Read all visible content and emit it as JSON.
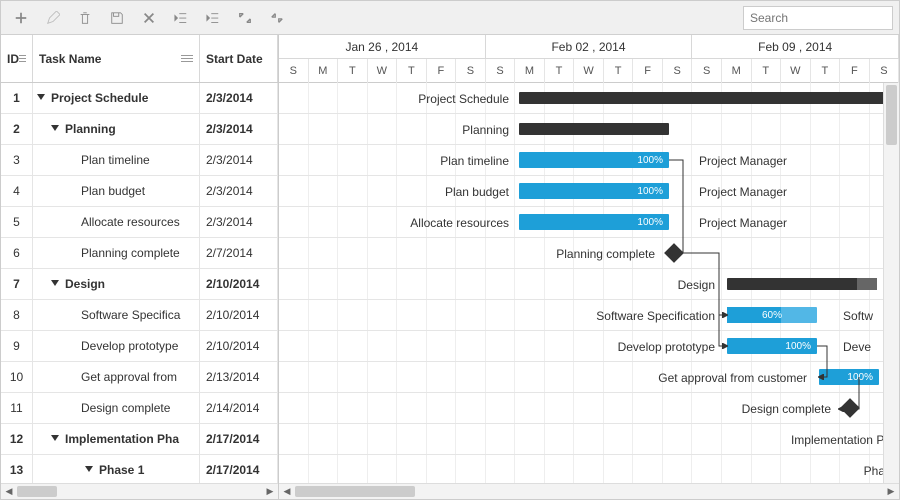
{
  "search": {
    "placeholder": "Search"
  },
  "columns": {
    "id": "ID",
    "task": "Task Name",
    "start": "Start Date"
  },
  "weeks": [
    "Jan 26 , 2014",
    "Feb 02 , 2014",
    "Feb 09 , 2014"
  ],
  "days": [
    "S",
    "M",
    "T",
    "W",
    "T",
    "F",
    "S",
    "S",
    "M",
    "T",
    "W",
    "T",
    "F",
    "S",
    "S",
    "M",
    "T",
    "W",
    "T",
    "F",
    "S"
  ],
  "rows": [
    {
      "id": "1",
      "name": "Project Schedule",
      "start": "2/3/2014",
      "summary": true,
      "ind": 1
    },
    {
      "id": "2",
      "name": "Planning",
      "start": "2/3/2014",
      "summary": true,
      "ind": 2
    },
    {
      "id": "3",
      "name": "Plan timeline",
      "start": "2/3/2014",
      "summary": false,
      "ind": 3
    },
    {
      "id": "4",
      "name": "Plan budget",
      "start": "2/3/2014",
      "summary": false,
      "ind": 3
    },
    {
      "id": "5",
      "name": "Allocate resources",
      "start": "2/3/2014",
      "summary": false,
      "ind": 3
    },
    {
      "id": "6",
      "name": "Planning complete",
      "start": "2/7/2014",
      "summary": false,
      "ind": 3
    },
    {
      "id": "7",
      "name": "Design",
      "start": "2/10/2014",
      "summary": true,
      "ind": 2
    },
    {
      "id": "8",
      "name": "Software Specification",
      "start": "2/10/2014",
      "summary": false,
      "ind": 3
    },
    {
      "id": "9",
      "name": "Develop prototype",
      "start": "2/10/2014",
      "summary": false,
      "ind": 3
    },
    {
      "id": "10",
      "name": "Get approval from customer",
      "start": "2/13/2014",
      "summary": false,
      "ind": 3
    },
    {
      "id": "11",
      "name": "Design complete",
      "start": "2/14/2014",
      "summary": false,
      "ind": 3
    },
    {
      "id": "12",
      "name": "Implementation Phase",
      "start": "2/17/2014",
      "summary": true,
      "ind": 2,
      "trunc": "Implementation Ph"
    },
    {
      "id": "13",
      "name": "Phase 1",
      "start": "2/17/2014",
      "summary": true,
      "ind": 4,
      "trunc": "Phas"
    }
  ],
  "chart_data": {
    "type": "gantt",
    "weeks": [
      "Jan 26 , 2014",
      "Feb 02 , 2014",
      "Feb 09 , 2014"
    ],
    "tasks": [
      {
        "id": 1,
        "name": "Project Schedule",
        "type": "summary",
        "start": "2/3/2014",
        "end": null
      },
      {
        "id": 2,
        "name": "Planning",
        "type": "summary",
        "start": "2/3/2014",
        "end": "2/7/2014"
      },
      {
        "id": 3,
        "name": "Plan timeline",
        "type": "task",
        "start": "2/3/2014",
        "end": "2/7/2014",
        "progress": 100,
        "resource": "Project Manager"
      },
      {
        "id": 4,
        "name": "Plan budget",
        "type": "task",
        "start": "2/3/2014",
        "end": "2/7/2014",
        "progress": 100,
        "resource": "Project Manager"
      },
      {
        "id": 5,
        "name": "Allocate resources",
        "type": "task",
        "start": "2/3/2014",
        "end": "2/7/2014",
        "progress": 100,
        "resource": "Project Manager"
      },
      {
        "id": 6,
        "name": "Planning complete",
        "type": "milestone",
        "date": "2/7/2014"
      },
      {
        "id": 7,
        "name": "Design",
        "type": "summary",
        "start": "2/10/2014",
        "end": "2/14/2014"
      },
      {
        "id": 8,
        "name": "Software Specification",
        "type": "task",
        "start": "2/10/2014",
        "end": "2/12/2014",
        "progress": 60,
        "resource": "Software"
      },
      {
        "id": 9,
        "name": "Develop prototype",
        "type": "task",
        "start": "2/10/2014",
        "end": "2/12/2014",
        "progress": 100,
        "resource": "Deve"
      },
      {
        "id": 10,
        "name": "Get approval from customer",
        "type": "task",
        "start": "2/13/2014",
        "end": "2/14/2014",
        "progress": 100
      },
      {
        "id": 11,
        "name": "Design complete",
        "type": "milestone",
        "date": "2/14/2014"
      },
      {
        "id": 12,
        "name": "Implementation Phase",
        "type": "summary",
        "start": "2/17/2014",
        "end": null
      },
      {
        "id": 13,
        "name": "Phase 1",
        "type": "summary",
        "start": "2/17/2014",
        "end": null
      }
    ],
    "labels": {
      "pct60": "60%",
      "pct100": "100%",
      "pm": "Project Manager",
      "sw": "Softw",
      "dev": "Deve",
      "impl": "Implementation Ph",
      "phase": "Phas",
      "project_schedule": "Project Schedule",
      "planning": "Planning",
      "plan_timeline": "Plan timeline",
      "plan_budget": "Plan budget",
      "allocate_resources": "Allocate resources",
      "planning_complete": "Planning complete",
      "design": "Design",
      "software_spec": "Software Specification",
      "develop_prototype": "Develop prototype",
      "get_approval": "Get approval from customer",
      "design_complete": "Design complete"
    }
  }
}
